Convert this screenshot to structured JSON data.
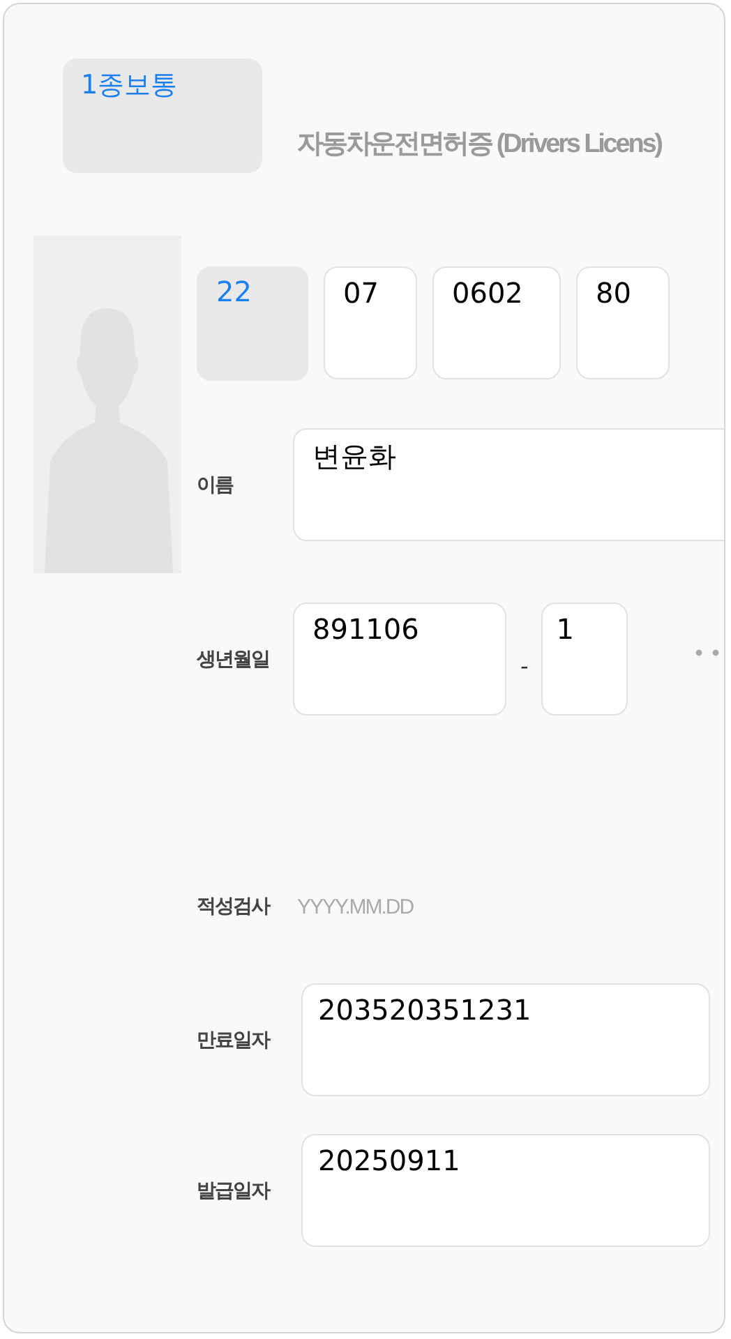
{
  "license_type": "1종보통",
  "title": "자동차운전면허증 (Drivers Licens)",
  "license_number": [
    {
      "value": "22",
      "kind": "region"
    },
    {
      "value": "07",
      "kind": "input"
    },
    {
      "value": "0602",
      "kind": "input"
    },
    {
      "value": "80",
      "kind": "input"
    }
  ],
  "name": {
    "label": "이름",
    "value": "변윤화"
  },
  "birth_date": {
    "label": "생년월일",
    "value": "891106",
    "separator": "-",
    "gender_digit": "1"
  },
  "aptitude_test": {
    "label": "적성검사",
    "placeholder": "YYYY.MM.DD"
  },
  "expiry_date": {
    "label": "만료일자",
    "value": "203520351231"
  },
  "issue_date": {
    "label": "발급일자",
    "value": "20250911"
  }
}
